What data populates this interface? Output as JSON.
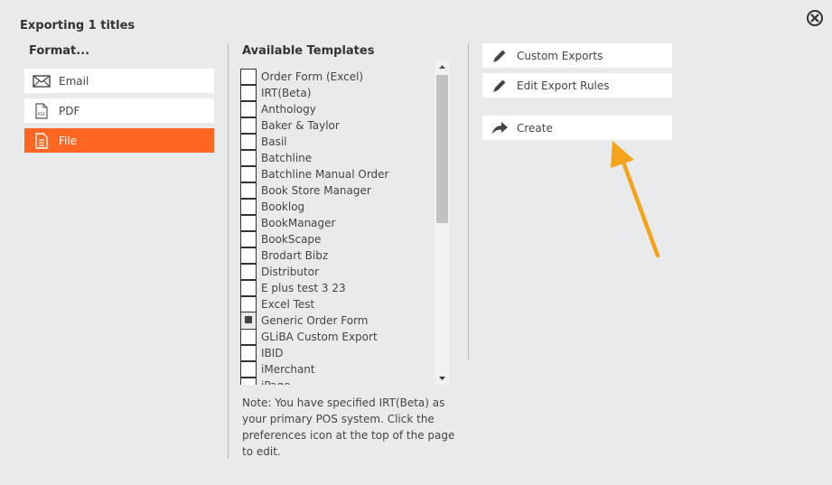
{
  "dialog": {
    "title": "Exporting 1 titles"
  },
  "format": {
    "heading": "Format...",
    "items": [
      {
        "label": "Email",
        "icon": "envelope-icon",
        "active": false
      },
      {
        "label": "PDF",
        "icon": "pdf-file-icon",
        "active": false
      },
      {
        "label": "File",
        "icon": "document-icon",
        "active": true
      }
    ],
    "active_color": "#ff6622"
  },
  "templates": {
    "heading": "Available Templates",
    "items": [
      {
        "label": "Order Form (Excel)",
        "checked": false
      },
      {
        "label": "IRT(Beta)",
        "checked": false
      },
      {
        "label": "Anthology",
        "checked": false
      },
      {
        "label": "Baker & Taylor",
        "checked": false
      },
      {
        "label": "Basil",
        "checked": false
      },
      {
        "label": "Batchline",
        "checked": false
      },
      {
        "label": "Batchline Manual Order",
        "checked": false
      },
      {
        "label": "Book Store Manager",
        "checked": false
      },
      {
        "label": "Booklog",
        "checked": false
      },
      {
        "label": "BookManager",
        "checked": false
      },
      {
        "label": "BookScape",
        "checked": false
      },
      {
        "label": "Brodart Bibz",
        "checked": false
      },
      {
        "label": "Distributor",
        "checked": false
      },
      {
        "label": "E plus test 3 23",
        "checked": false
      },
      {
        "label": "Excel Test",
        "checked": false
      },
      {
        "label": "Generic Order Form",
        "checked": true
      },
      {
        "label": "GLiBA Custom Export",
        "checked": false
      },
      {
        "label": "IBID",
        "checked": false
      },
      {
        "label": "iMerchant",
        "checked": false
      },
      {
        "label": "iPage",
        "checked": false
      }
    ],
    "note": "Note: You have specified IRT(Beta) as your primary POS system. Click the preferences icon at the top of the page to edit."
  },
  "actions": {
    "custom_exports": "Custom Exports",
    "edit_export_rules": "Edit Export Rules",
    "create": "Create"
  },
  "annotation": {
    "arrow_color": "#f5a31a"
  }
}
